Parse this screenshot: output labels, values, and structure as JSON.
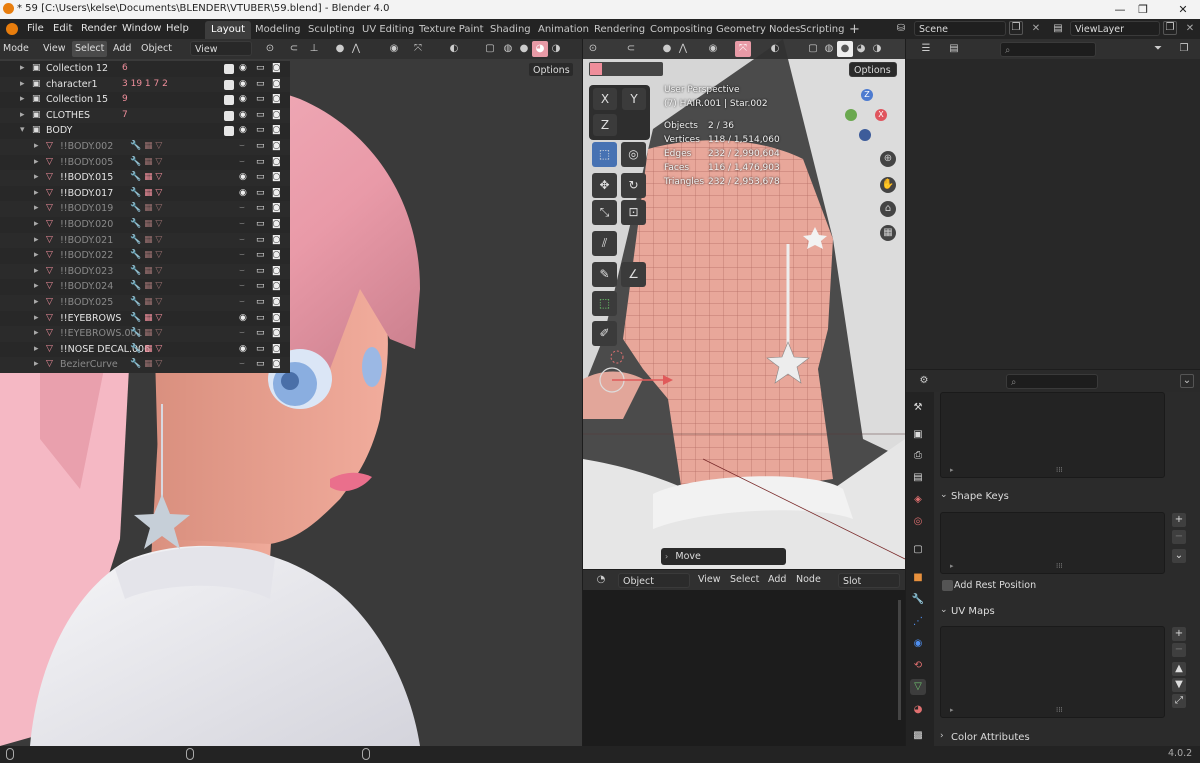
{
  "window": {
    "title": "* 59 [C:\\Users\\kelse\\Documents\\BLENDER\\VTUBER\\59.blend] - Blender 4.0",
    "minimize": "—",
    "maximize": "❐",
    "close": "✕"
  },
  "menu": [
    "File",
    "Edit",
    "Render",
    "Window",
    "Help"
  ],
  "workspaces": [
    "Layout",
    "Modeling",
    "Sculpting",
    "UV Editing",
    "Texture Paint",
    "Shading",
    "Animation",
    "Rendering",
    "Compositing",
    "Geometry Nodes",
    "Scripting"
  ],
  "add_workspace": "+",
  "scene": {
    "name": "Scene",
    "view_layer": "ViewLayer"
  },
  "left_view": {
    "mode": "Mode",
    "menus": [
      "View",
      "Select",
      "Add",
      "Object"
    ],
    "orientation": "View",
    "options": "Options"
  },
  "mid_view": {
    "options": "Options",
    "perspective": "User Perspective",
    "object": "(7) HAIR.001 | Star.002",
    "stats": [
      {
        "label": "Objects",
        "value": "2 / 36"
      },
      {
        "label": "Vertices",
        "value": "118 / 1,514,060"
      },
      {
        "label": "Edges",
        "value": "232 / 2,990,604"
      },
      {
        "label": "Faces",
        "value": "116 / 1,476,903"
      },
      {
        "label": "Triangles",
        "value": "232 / 2,953,678"
      }
    ],
    "axes": [
      "X",
      "Y",
      "Z"
    ],
    "move_panel": "Move"
  },
  "node_editor": {
    "object_dd": "Object",
    "menus": [
      "View",
      "Select",
      "Add",
      "Node"
    ],
    "slot": "Slot"
  },
  "outliner": {
    "rows": [
      {
        "name": "Collection 12",
        "extra": "6",
        "dim": false
      },
      {
        "name": "character1",
        "extra": "3 19 1 7 2",
        "dim": false
      },
      {
        "name": "Collection 15",
        "extra": "9",
        "dim": false
      },
      {
        "name": "CLOTHES",
        "extra": "7",
        "dim": false
      },
      {
        "name": "BODY",
        "extra": "",
        "dim": false
      },
      {
        "name": "!!BODY.002",
        "extra": "",
        "dim": true
      },
      {
        "name": "!!BODY.005",
        "extra": "",
        "dim": true
      },
      {
        "name": "!!BODY.015",
        "extra": "",
        "dim": false
      },
      {
        "name": "!!BODY.017",
        "extra": "",
        "dim": false
      },
      {
        "name": "!!BODY.019",
        "extra": "",
        "dim": true
      },
      {
        "name": "!!BODY.020",
        "extra": "",
        "dim": true
      },
      {
        "name": "!!BODY.021",
        "extra": "",
        "dim": true
      },
      {
        "name": "!!BODY.022",
        "extra": "",
        "dim": true
      },
      {
        "name": "!!BODY.023",
        "extra": "",
        "dim": true
      },
      {
        "name": "!!BODY.024",
        "extra": "",
        "dim": true
      },
      {
        "name": "!!BODY.025",
        "extra": "",
        "dim": true
      },
      {
        "name": "!!EYEBROWS",
        "extra": "",
        "dim": false
      },
      {
        "name": "!!EYEBROWS.001",
        "extra": "",
        "dim": true
      },
      {
        "name": "!!NOSE DECAL.006",
        "extra": "",
        "dim": false
      },
      {
        "name": "BezierCurve",
        "extra": "",
        "dim": true
      }
    ]
  },
  "properties": {
    "shape_keys": "Shape Keys",
    "add_rest_position": "Add Rest Position",
    "uv_maps": "UV Maps",
    "color_attributes": "Color Attributes"
  },
  "status": {
    "version": "4.0.2"
  },
  "colors": {
    "accent": "#4772b3",
    "hair": "#f0a8b4",
    "skin": "#e8a090",
    "mesh_pink": "#e8a79a"
  }
}
